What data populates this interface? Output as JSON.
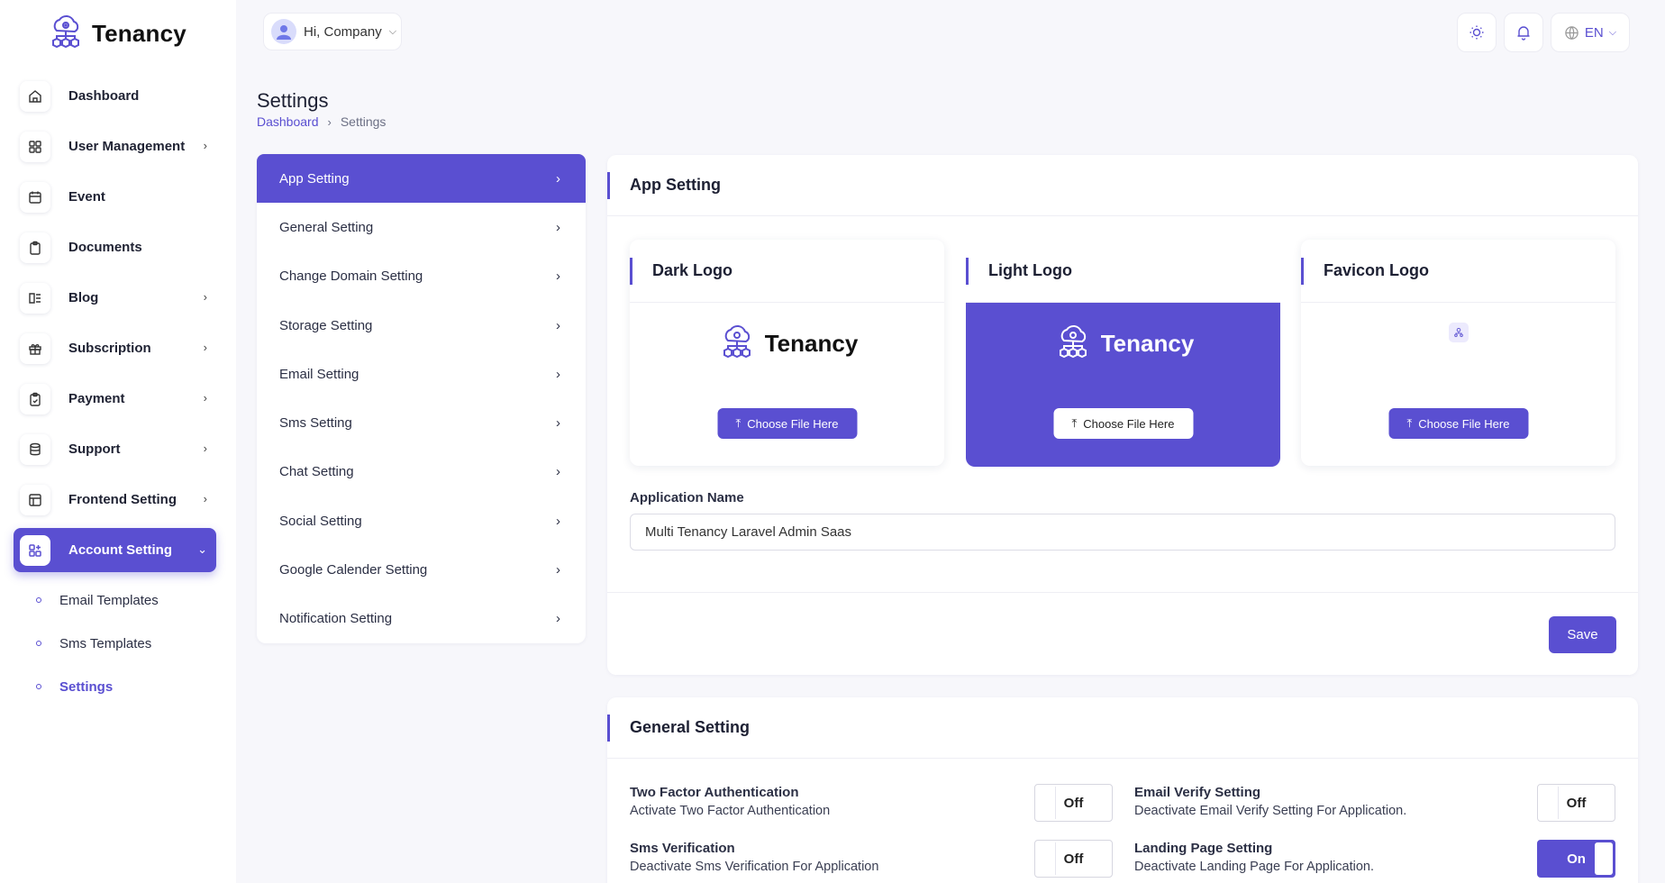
{
  "brand": {
    "name": "Tenancy"
  },
  "header": {
    "greeting": "Hi, Company",
    "language": "EN"
  },
  "sidebar": {
    "items": [
      {
        "label": "Dashboard",
        "icon": "home-icon",
        "has_children": false
      },
      {
        "label": "User Management",
        "icon": "grid-icon",
        "has_children": true
      },
      {
        "label": "Event",
        "icon": "calendar-icon",
        "has_children": false
      },
      {
        "label": "Documents",
        "icon": "clipboard-icon",
        "has_children": false
      },
      {
        "label": "Blog",
        "icon": "blog-icon",
        "has_children": true
      },
      {
        "label": "Subscription",
        "icon": "gift-icon",
        "has_children": true
      },
      {
        "label": "Payment",
        "icon": "payment-icon",
        "has_children": true
      },
      {
        "label": "Support",
        "icon": "database-icon",
        "has_children": true
      },
      {
        "label": "Frontend Setting",
        "icon": "layout-icon",
        "has_children": true
      },
      {
        "label": "Account Setting",
        "icon": "apps-icon",
        "has_children": true,
        "active": true
      }
    ],
    "sub_items": [
      {
        "label": "Email Templates"
      },
      {
        "label": "Sms Templates"
      },
      {
        "label": "Settings",
        "active": true
      }
    ]
  },
  "page": {
    "title": "Settings",
    "breadcrumb": [
      "Dashboard",
      "Settings"
    ]
  },
  "settings_menu": [
    "App Setting",
    "General Setting",
    "Change Domain Setting",
    "Storage Setting",
    "Email Setting",
    "Sms Setting",
    "Chat Setting",
    "Social Setting",
    "Google Calender Setting",
    "Notification Setting"
  ],
  "app_setting": {
    "title": "App Setting",
    "logos": [
      {
        "title": "Dark Logo",
        "preview_text": "Tenancy",
        "button": "Choose File Here"
      },
      {
        "title": "Light Logo",
        "preview_text": "Tenancy",
        "button": "Choose File Here"
      },
      {
        "title": "Favicon Logo",
        "button": "Choose File Here"
      }
    ],
    "app_name_label": "Application Name",
    "app_name_value": "Multi Tenancy Laravel Admin Saas",
    "save_label": "Save"
  },
  "general_setting": {
    "title": "General Setting",
    "options": [
      {
        "title": "Two Factor Authentication",
        "desc": "Activate Two Factor Authentication",
        "state": "Off"
      },
      {
        "title": "Email Verify Setting",
        "desc": "Deactivate Email Verify Setting For Application.",
        "state": "Off"
      },
      {
        "title": "Sms Verification",
        "desc": "Deactivate Sms Verification For Application",
        "state": "Off"
      },
      {
        "title": "Landing Page Setting",
        "desc": "Deactivate Landing Page For Application.",
        "state": "On"
      }
    ]
  },
  "colors": {
    "accent": "#5a4fd1"
  }
}
